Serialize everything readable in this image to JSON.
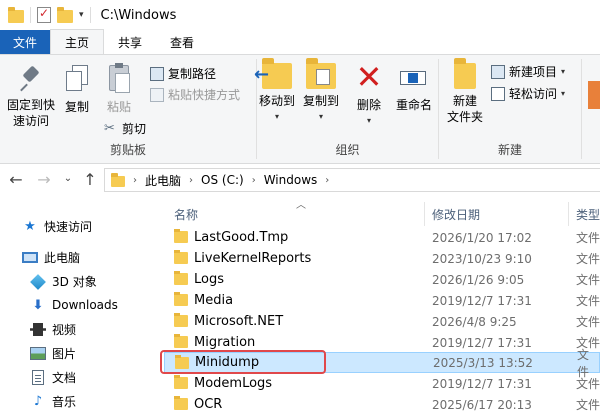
{
  "window": {
    "title": "C:\\Windows"
  },
  "tabs": [
    "文件",
    "主页",
    "共享",
    "查看"
  ],
  "ribbon": {
    "clipboard": {
      "pin_label_1": "固定到快",
      "pin_label_2": "速访问",
      "copy_label": "复制",
      "paste_label": "粘贴",
      "copy_path": "复制路径",
      "paste_shortcut": "粘贴快捷方式",
      "cut": "剪切",
      "group_label": "剪贴板"
    },
    "organize": {
      "move_to": "移动到",
      "copy_to": "复制到",
      "delete": "删除",
      "rename": "重命名",
      "group_label": "组织"
    },
    "new": {
      "new_folder_1": "新建",
      "new_folder_2": "文件夹",
      "new_item": "新建项目",
      "easy_access": "轻松访问",
      "group_label": "新建"
    }
  },
  "address": {
    "crumbs": [
      "此电脑",
      "OS (C:)",
      "Windows"
    ]
  },
  "nav_pane": {
    "items": [
      {
        "label": "快速访问",
        "icon": "star-icon"
      },
      {
        "label": "此电脑",
        "icon": "computer-icon"
      },
      {
        "label": "3D 对象",
        "icon": "3d-objects-icon"
      },
      {
        "label": "Downloads",
        "icon": "download-icon"
      },
      {
        "label": "视频",
        "icon": "video-icon"
      },
      {
        "label": "图片",
        "icon": "pictures-icon"
      },
      {
        "label": "文档",
        "icon": "documents-icon"
      },
      {
        "label": "音乐",
        "icon": "music-icon"
      }
    ]
  },
  "file_list": {
    "columns": {
      "name": "名称",
      "modified": "修改日期",
      "type": "类型"
    },
    "rows": [
      {
        "name": "LastGood.Tmp",
        "modified": "2026/1/20 17:02",
        "type": "文件"
      },
      {
        "name": "LiveKernelReports",
        "modified": "2023/10/23 9:10",
        "type": "文件"
      },
      {
        "name": "Logs",
        "modified": "2026/1/26 9:05",
        "type": "文件"
      },
      {
        "name": "Media",
        "modified": "2019/12/7 17:31",
        "type": "文件"
      },
      {
        "name": "Microsoft.NET",
        "modified": "2026/4/8 9:25",
        "type": "文件"
      },
      {
        "name": "Migration",
        "modified": "2019/12/7 17:31",
        "type": "文件"
      },
      {
        "name": "Minidump",
        "modified": "2025/3/13 13:52",
        "type": "文件"
      },
      {
        "name": "ModemLogs",
        "modified": "2019/12/7 17:31",
        "type": "文件"
      },
      {
        "name": "OCR",
        "modified": "2025/6/17 20:13",
        "type": "文件"
      }
    ],
    "selected_row": "Minidump"
  },
  "colors": {
    "file_tab": "#1a63b8",
    "selection": "#cce8ff",
    "highlight": "#e0484b",
    "folder": "#f6cb52"
  }
}
